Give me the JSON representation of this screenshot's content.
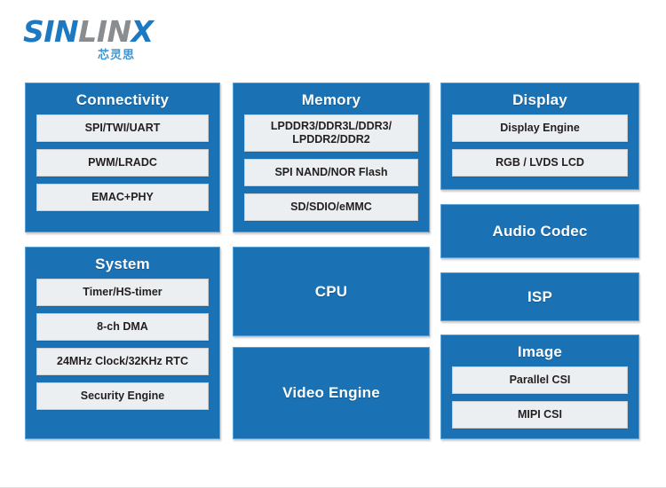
{
  "logo": {
    "name": "SINLINX",
    "part_a": "SIN",
    "part_b": "LIN",
    "part_c": "X",
    "chinese": "芯灵思",
    "color_blue": "#1d7ac2",
    "color_gray": "#8a8d90"
  },
  "theme": {
    "block_blue": "#1a72b5",
    "block_border": "#5ba3d6",
    "item_bg": "#eceff1",
    "item_border": "#c9ced2",
    "text_dark": "#231f20",
    "text_light": "#ffffff"
  },
  "diagram": {
    "columns": [
      {
        "name": "column-left",
        "blocks": [
          {
            "title": "Connectivity",
            "items": [
              {
                "label": "SPI/TWI/UART"
              },
              {
                "label": "PWM/LRADC"
              },
              {
                "label": "EMAC+PHY"
              }
            ]
          },
          {
            "title": "System",
            "items": [
              {
                "label": "Timer/HS-timer"
              },
              {
                "label": "8-ch DMA"
              },
              {
                "label": "24MHz Clock/32KHz RTC"
              },
              {
                "label": "Security Engine"
              }
            ]
          }
        ]
      },
      {
        "name": "column-middle",
        "blocks": [
          {
            "title": "Memory",
            "items": [
              {
                "label": "LPDDR3/DDR3L/DDR3/ LPDDR2/DDR2"
              },
              {
                "label": "SPI NAND/NOR Flash"
              },
              {
                "label": "SD/SDIO/eMMC"
              }
            ]
          },
          {
            "title": "CPU",
            "items": []
          },
          {
            "title": "Video Engine",
            "items": []
          }
        ]
      },
      {
        "name": "column-right",
        "blocks": [
          {
            "title": "Display",
            "items": [
              {
                "label": "Display Engine"
              },
              {
                "label": "RGB / LVDS  LCD"
              }
            ]
          },
          {
            "title": "Audio Codec",
            "items": []
          },
          {
            "title": "ISP",
            "items": []
          },
          {
            "title": "Image",
            "items": [
              {
                "label": "Parallel CSI"
              },
              {
                "label": "MIPI CSI"
              }
            ]
          }
        ]
      }
    ]
  },
  "memory_ddr": {
    "line1": "LPDDR3/DDR3L/DDR3/",
    "line2": "LPDDR2/DDR2"
  }
}
